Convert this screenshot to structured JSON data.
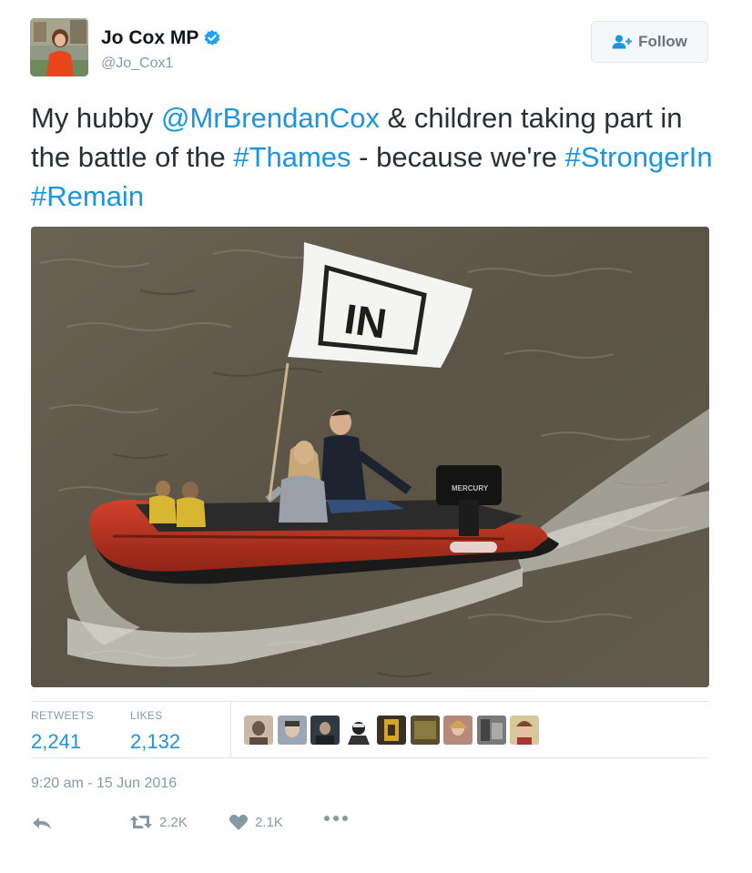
{
  "author": {
    "name": "Jo Cox MP",
    "handle": "@Jo_Cox1",
    "verified_icon": "verified-badge-icon"
  },
  "follow_button": {
    "label": "Follow",
    "icon": "add-person-icon"
  },
  "tweet": {
    "segments": [
      {
        "text": "My hubby ",
        "link": false
      },
      {
        "text": "@MrBrendanCox",
        "link": true
      },
      {
        "text": " & children taking part in the battle of the ",
        "link": false
      },
      {
        "text": "#Thames",
        "link": true
      },
      {
        "text": " - because we're ",
        "link": false
      },
      {
        "text": "#StrongerIn",
        "link": true
      },
      {
        "text": " ",
        "link": false
      },
      {
        "text": "#Remain",
        "link": true
      }
    ],
    "photo": {
      "flag_text": "IN",
      "motor_text": "MERCURY"
    }
  },
  "stats": {
    "retweets_label": "RETWEETS",
    "retweets_value": "2,241",
    "likes_label": "LIKES",
    "likes_value": "2,132"
  },
  "timestamp": "9:20 am - 15 Jun 2016",
  "actions": {
    "reply_icon": "reply-icon",
    "retweet_icon": "retweet-icon",
    "retweet_count": "2.2K",
    "like_icon": "heart-icon",
    "like_count": "2.1K",
    "more_icon": "more-dots-icon"
  },
  "colors": {
    "link": "#1b95e0",
    "muted": "#8899a6",
    "text": "#292f33"
  }
}
